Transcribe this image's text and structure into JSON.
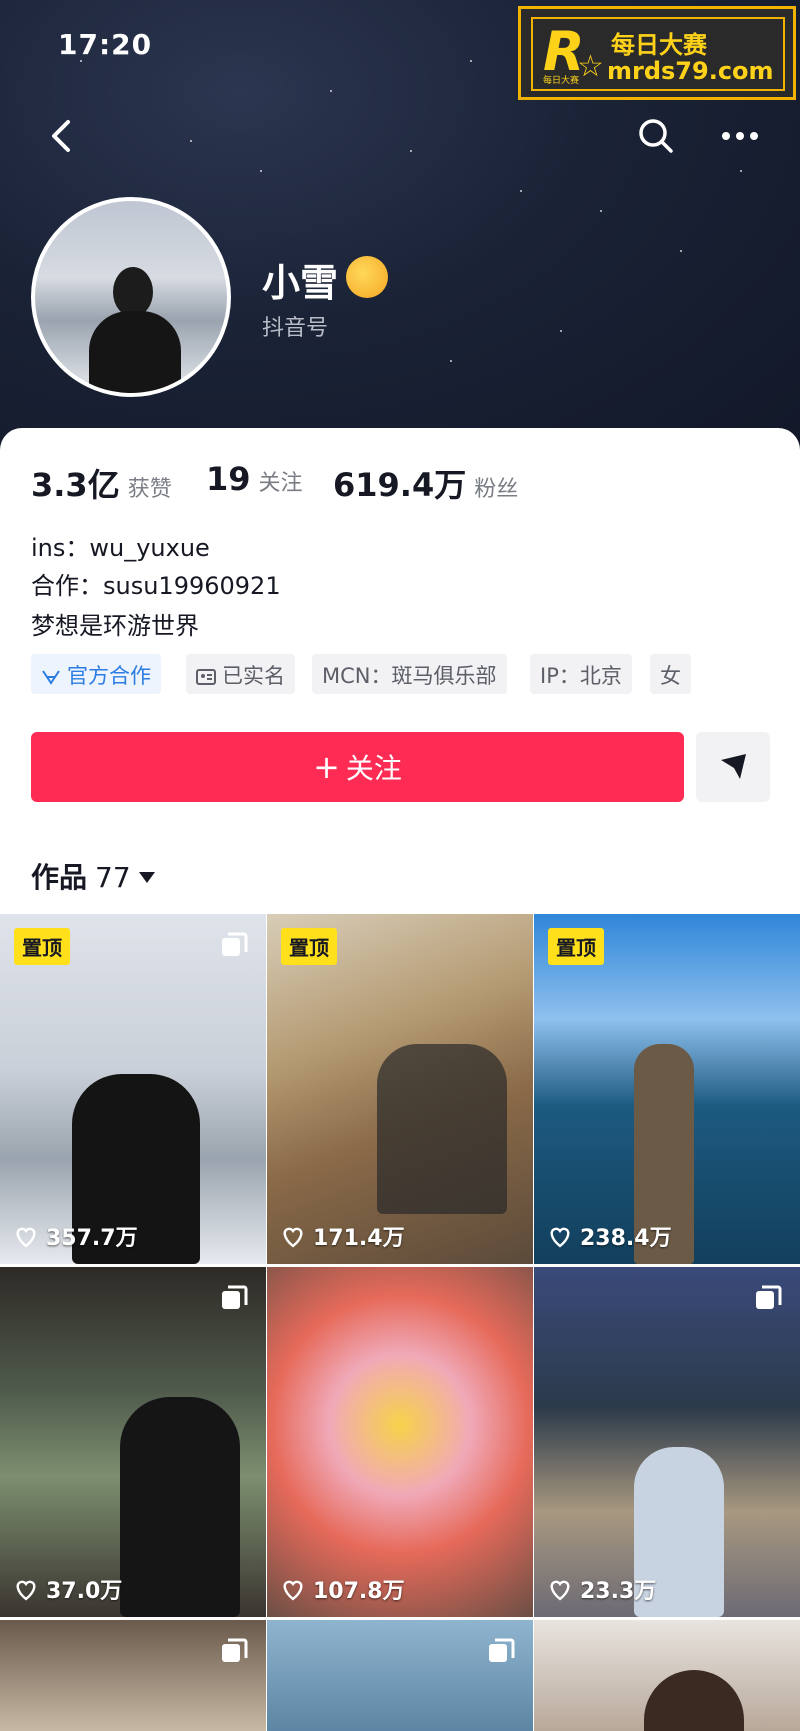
{
  "status_bar": {
    "time": "17:20"
  },
  "watermark": {
    "brand_cn": "每日大赛",
    "brand_small": "每日大赛",
    "url": "mrds79.com",
    "logo_letter": "R"
  },
  "profile": {
    "nickname": "小雪",
    "douyin_id_label": "抖音号",
    "stats": [
      {
        "value": "3.3亿",
        "label": "获赞"
      },
      {
        "value": "19",
        "label": "关注"
      },
      {
        "value": "619.4万",
        "label": "粉丝"
      }
    ],
    "bio": [
      "ins：wu_yuxue",
      "合作：susu19960921",
      "梦想是环游世界"
    ],
    "tags": {
      "official": "官方合作",
      "verified": "已实名",
      "mcn": "MCN：斑马俱乐部",
      "ip": "IP：北京",
      "gender": "女"
    },
    "follow_label": "关注",
    "follow_plus": "+"
  },
  "works": {
    "label": "作品",
    "count": "77"
  },
  "grid": [
    {
      "pinned": "置顶",
      "likes": "357.7万"
    },
    {
      "pinned": "置顶",
      "likes": "171.4万"
    },
    {
      "pinned": "置顶",
      "likes": "238.4万"
    },
    {
      "likes": "37.0万"
    },
    {
      "likes": "107.8万"
    },
    {
      "likes": "23.3万"
    }
  ],
  "colors": {
    "accent": "#fe2c55",
    "pin": "#ffe01b",
    "official_tag": "#2b7de1"
  },
  "icons": [
    "back-icon",
    "search-icon",
    "more-icon",
    "send-icon",
    "heart-icon",
    "multi-image-icon",
    "official-icon",
    "id-card-icon"
  ]
}
